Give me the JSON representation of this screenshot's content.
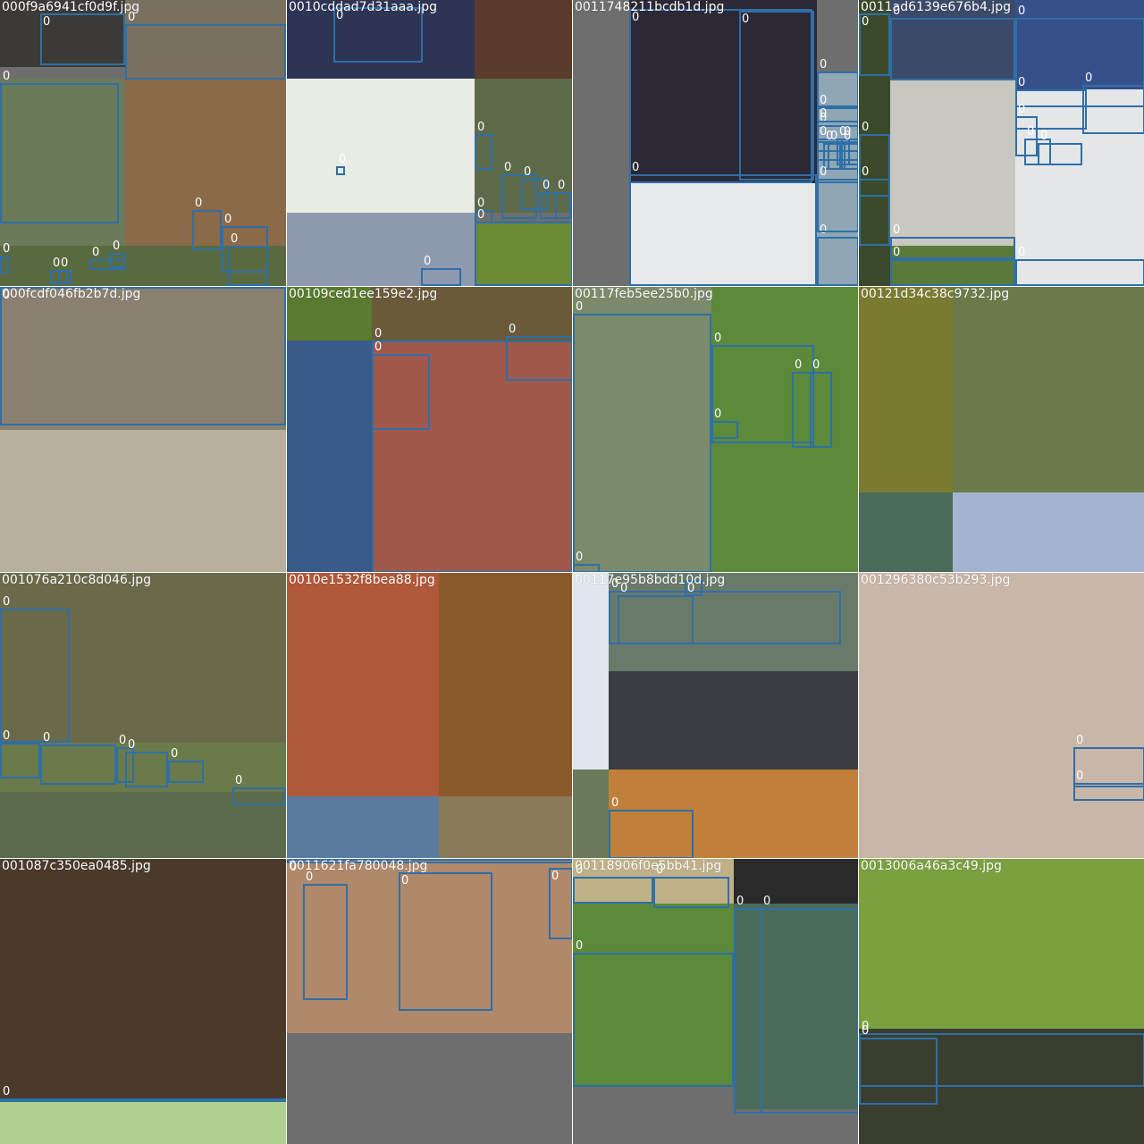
{
  "grid": {
    "columns": 4,
    "rows": 4,
    "filler_color": "#6e6e6e",
    "box_color": "#2f6fa8",
    "tiles": [
      {
        "filename": "000f9a6941cf0d9f.jpg",
        "box_labels": [
          "0",
          "0",
          "0",
          "0",
          "0",
          "0",
          "0",
          "0",
          "0",
          "0",
          "0"
        ]
      },
      {
        "filename": "0010cddad7d31aaa.jpg",
        "box_labels": [
          "0",
          "0",
          "0",
          "0",
          "0",
          "0",
          "0",
          "0",
          "0",
          "0",
          "0"
        ]
      },
      {
        "filename": "0011748211bcdb1d.jpg",
        "box_labels": [
          "0",
          "0",
          "0",
          "0",
          "0",
          "0",
          "0",
          "0",
          "0",
          "0",
          "0",
          "0",
          "0",
          "0",
          "0"
        ]
      },
      {
        "filename": "0011ad6139e676b4.jpg",
        "box_labels": [
          "0",
          "0",
          "0",
          "0",
          "0",
          "0",
          "0",
          "0",
          "0",
          "0",
          "0",
          "0",
          "0"
        ]
      },
      {
        "filename": "000fcdf046fb2b7d.jpg",
        "box_labels": [
          "0",
          "0"
        ]
      },
      {
        "filename": "00109ced1ee159e2.jpg",
        "box_labels": [
          "0",
          "0",
          "0"
        ]
      },
      {
        "filename": "00117feb5ee25b0.jpg",
        "box_labels": [
          "0",
          "0",
          "0",
          "0",
          "0",
          "0"
        ]
      },
      {
        "filename": "00121d34c38c9732.jpg",
        "box_labels": []
      },
      {
        "filename": "001076a210c8d046.jpg",
        "box_labels": [
          "0",
          "0",
          "0",
          "0",
          "0",
          "0",
          "0"
        ]
      },
      {
        "filename": "0010e1532f8bea88.jpg",
        "box_labels": []
      },
      {
        "filename": "00117e95b8bdd10d.jpg",
        "box_labels": [
          "0",
          "0",
          "0",
          "0"
        ]
      },
      {
        "filename": "001296380c53b293.jpg",
        "box_labels": [
          "0",
          "0"
        ]
      },
      {
        "filename": "001087c350ea0485.jpg",
        "box_labels": [
          "0"
        ]
      },
      {
        "filename": "0011621fa780048.jpg",
        "box_labels": [
          "0",
          "0",
          "0",
          "0"
        ]
      },
      {
        "filename": "00118906f0e5bb41.jpg",
        "box_labels": [
          "0",
          "0",
          "0",
          "0",
          "0"
        ]
      },
      {
        "filename": "0013006a46a3c49.jpg",
        "box_labels": [
          "0",
          "0"
        ]
      }
    ]
  }
}
